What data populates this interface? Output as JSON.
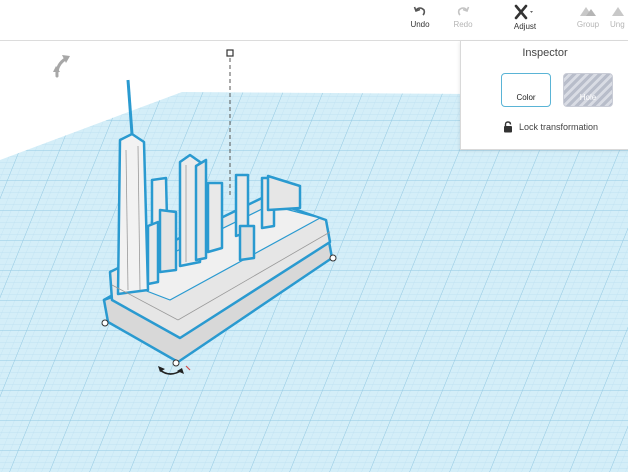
{
  "toolbar": {
    "undo": "Undo",
    "redo": "Redo",
    "adjust": "Adjust",
    "group": "Group",
    "ungroup": "Ung"
  },
  "inspector": {
    "title": "Inspector",
    "color_label": "Color",
    "hole_label": "Hole",
    "lock_label": "Lock transformation"
  },
  "colors": {
    "grid_fill": "#d4eef8",
    "grid_line": "#a7d4e8",
    "selection_outline": "#2a9ad0",
    "model_fill": "#e3e3e3"
  }
}
